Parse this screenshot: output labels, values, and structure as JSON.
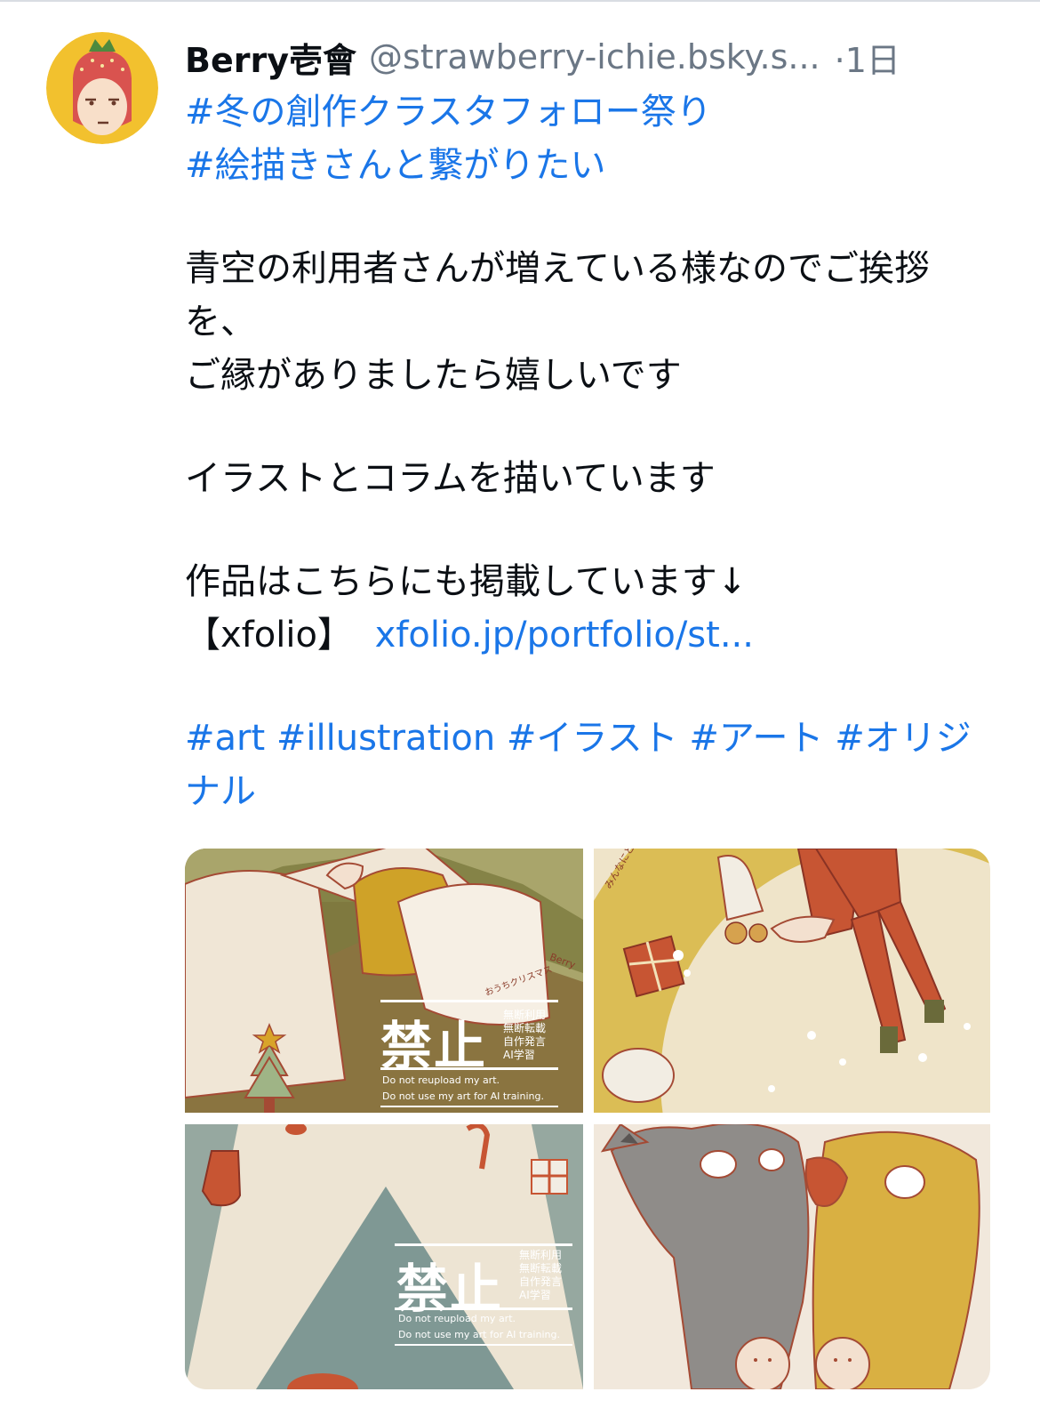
{
  "post": {
    "display_name": "Berry壱會",
    "handle": "@strawberry-ichie.bsky.s...",
    "time": "·1日",
    "hashtags_top": [
      "#冬の創作クラスタフォロー祭り",
      "#絵描きさんと繋がりたい"
    ],
    "paragraph_1": "青空の利用者さんが増えている様なのでご挨拶を、",
    "paragraph_1b": "ご縁がありましたら嬉しいです",
    "paragraph_2": "イラストとコラムを描いています",
    "paragraph_3": "作品はこちらにも掲載しています↓",
    "link_prefix": "【xfolio】",
    "link_text": "xfolio.jp/portfolio/st...",
    "hashtags_bottom": [
      "#art",
      "#illustration",
      "#イラスト",
      "#アート",
      "#オリジナル"
    ]
  },
  "watermark": {
    "big": "禁止",
    "lines": [
      "無断利用",
      "無断転載",
      "自作発言",
      "AI学習"
    ],
    "en_1": "Do not reupload my art.",
    "en_2": "Do not use my art for AI training."
  },
  "images": {
    "img1_signature": "Berry",
    "img1_caption": "おうちクリスマス",
    "img2_caption": "みんなにとどけ"
  },
  "colors": {
    "link": "#1a76e8",
    "muted": "#6b7785",
    "avatar_bg": "#f2c12e",
    "strawberry": "#d9534f"
  }
}
